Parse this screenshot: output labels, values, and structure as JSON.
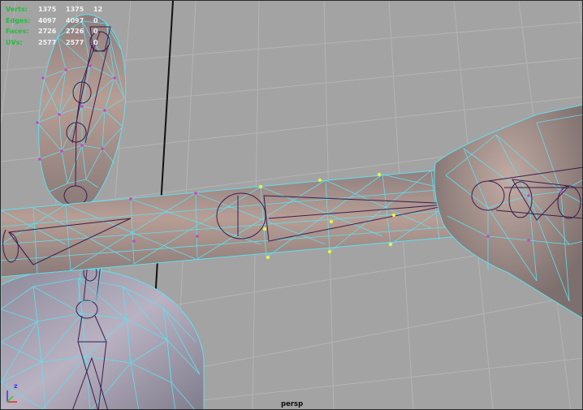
{
  "stats": {
    "rows": [
      {
        "label": "Verts:",
        "total": "1375",
        "visible": "1375",
        "selected": "12"
      },
      {
        "label": "Edges:",
        "total": "4097",
        "visible": "4097",
        "selected": "0"
      },
      {
        "label": "Faces:",
        "total": "2726",
        "visible": "2726",
        "selected": "0"
      },
      {
        "label": "UVs:",
        "total": "2577",
        "visible": "2577",
        "selected": "0"
      }
    ]
  },
  "camera": {
    "label": "persp"
  },
  "axis_gizmo": {
    "z_label": "z"
  },
  "colors": {
    "wire": "#5fe0f0",
    "inner_wire": "#3b1d4d",
    "selected_vertex": "#e8f04a",
    "vertex": "#d040c0",
    "hud_label": "#1fbf3a"
  }
}
